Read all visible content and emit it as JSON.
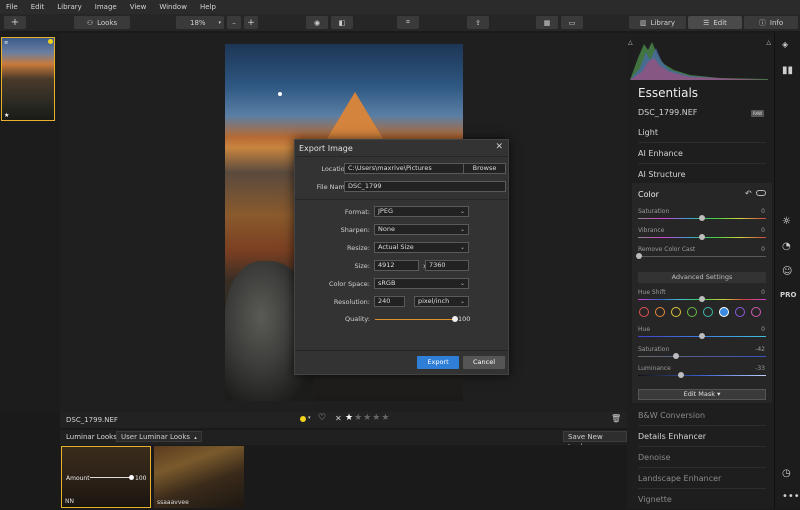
{
  "menu": [
    "File",
    "Edit",
    "Library",
    "Image",
    "View",
    "Window",
    "Help"
  ],
  "toolbar": {
    "add_label": "+",
    "looks_label": "Looks",
    "zoom_value": "18%",
    "zoom_minus": "–",
    "zoom_plus": "+",
    "library_tab": "Library",
    "edit_tab": "Edit",
    "info_tab": "Info"
  },
  "filmstrip": {
    "filename": "DSC_1799.NEF",
    "stars_filled": 1,
    "stars_total": 5
  },
  "looks": {
    "label": "Luminar Looks:",
    "selected": "User Luminar Looks",
    "save_new": "Save New Look...",
    "items": [
      {
        "name": "NN",
        "amount_label": "Amount",
        "amount_value": "100"
      },
      {
        "name": "ssaaavvee"
      }
    ]
  },
  "panel": {
    "title": "Essentials",
    "filename": "DSC_1799.NEF",
    "raw_badge": "RAW",
    "sections_top": [
      "Light",
      "AI Enhance",
      "AI Structure"
    ],
    "color": {
      "title": "Color",
      "saturation_label": "Saturation",
      "saturation_value": "0",
      "vibrance_label": "Vibrance",
      "vibrance_value": "0",
      "cast_label": "Remove Color Cast",
      "cast_value": "0",
      "advanced_label": "Advanced Settings",
      "hue_shift_label": "Hue Shift",
      "hue_shift_value": "0",
      "hue_label": "Hue",
      "hue_value": "0",
      "sat2_label": "Saturation",
      "sat2_value": "-42",
      "lum_label": "Luminance",
      "lum_value": "-33",
      "edit_mask_label": "Edit Mask ▾",
      "swatches": [
        "#e05050",
        "#e08a3a",
        "#d8c83a",
        "#6ab84a",
        "#3ab8a8",
        "#3a8ae0",
        "#8a5ae0",
        "#d05ab0"
      ],
      "selected_swatch": 5
    },
    "sections_bottom": [
      "B&W Conversion",
      "Details Enhancer",
      "Denoise",
      "Landscape Enhancer",
      "Vignette"
    ]
  },
  "dialog": {
    "title": "Export Image",
    "location_label": "Location:",
    "location_value": "C:\\Users\\maxrive\\Pictures",
    "browse_label": "Browse",
    "filename_label": "File Name:",
    "filename_value": "DSC_1799",
    "format_label": "Format:",
    "format_value": "JPEG",
    "sharpen_label": "Sharpen:",
    "sharpen_value": "None",
    "resize_label": "Resize:",
    "resize_value": "Actual Size",
    "size_label": "Size:",
    "width_value": "4912",
    "x_label": "x",
    "height_value": "7360",
    "colorspace_label": "Color Space:",
    "colorspace_value": "sRGB",
    "resolution_label": "Resolution:",
    "resolution_value": "240",
    "resolution_unit": "pixel/inch",
    "quality_label": "Quality:",
    "quality_value": "100",
    "export_label": "Export",
    "cancel_label": "Cancel"
  }
}
